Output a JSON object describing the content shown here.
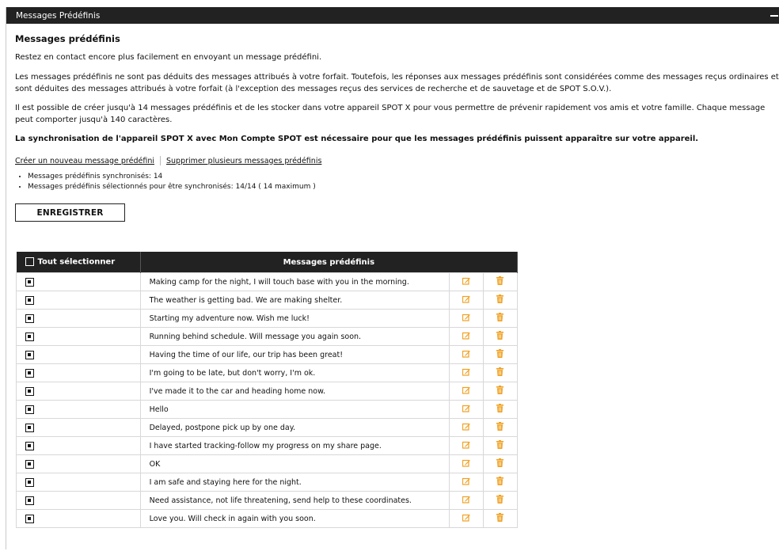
{
  "panel": {
    "title": "Messages Prédéfinis",
    "collapse_icon": "minus-icon"
  },
  "section": {
    "title": "Messages prédéfinis",
    "p1": "Restez en contact encore plus facilement en envoyant un message prédéfini.",
    "p2": "Les messages prédéfinis ne sont pas déduits des messages attribués à votre forfait. Toutefois, les réponses aux messages prédéfinis sont considérées comme des messages reçus ordinaires et sont déduites des messages attribués à votre forfait (à l'exception des messages reçus des services de recherche et de sauvetage et de SPOT S.O.V.).",
    "p3": "Il est possible de créer jusqu'à 14 messages prédéfinis et de les stocker dans votre appareil SPOT X pour vous permettre de prévenir rapidement vos amis et votre famille. Chaque message peut comporter jusqu'à 140 caractères.",
    "p4": "La synchronisation de l'appareil SPOT X avec Mon Compte SPOT est nécessaire pour que les messages prédéfinis puissent apparaître sur votre appareil."
  },
  "links": {
    "create": "Créer un nouveau message prédéfini",
    "delete_multi": "Supprimer plusieurs messages prédéfinis"
  },
  "stats": {
    "synced": "Messages prédéfinis synchronisés: 14",
    "selected": "Messages prédéfinis sélectionnés pour être synchronisés: 14/14 ( 14 maximum )"
  },
  "save_label": "ENREGISTRER",
  "table": {
    "select_all": "Tout sélectionner",
    "messages_header": "Messages prédéfinis",
    "rows": [
      "Making camp for the night, I will touch base with you in the morning.",
      "The weather is getting bad. We are making shelter.",
      "Starting my adventure now. Wish me luck!",
      "Running behind schedule. Will message you again soon.",
      "Having the time of our life, our trip has been great!",
      "I'm going to be late, but don't worry, I'm ok.",
      "I've made it to the car and heading home now.",
      "Hello",
      "Delayed, postpone pick up by one day.",
      "I have started tracking-follow my progress on my share page.",
      "OK",
      "I am safe and staying here for the night.",
      "Need assistance, not life threatening, send help to these coordinates.",
      "Love you. Will check in again with you soon."
    ]
  },
  "colors": {
    "header_bg": "#222222",
    "icon_orange": "#f0a020"
  }
}
